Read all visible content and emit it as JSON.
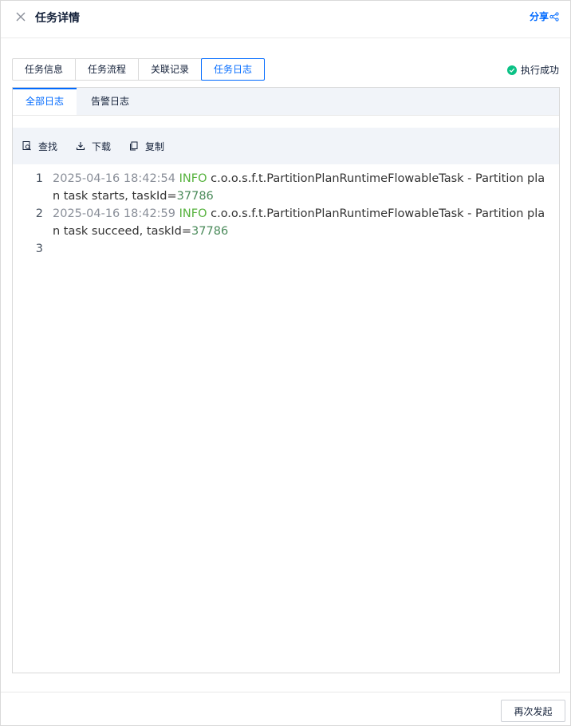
{
  "header": {
    "title": "任务详情",
    "share_label": "分享"
  },
  "tabs": [
    {
      "label": "任务信息",
      "active": false
    },
    {
      "label": "任务流程",
      "active": false
    },
    {
      "label": "关联记录",
      "active": false
    },
    {
      "label": "任务日志",
      "active": true
    }
  ],
  "status": {
    "label": "执行成功",
    "color": "#0ac185"
  },
  "subtabs": [
    {
      "label": "全部日志",
      "active": true
    },
    {
      "label": "告警日志",
      "active": false
    }
  ],
  "toolbar": {
    "search_label": "查找",
    "download_label": "下载",
    "copy_label": "复制"
  },
  "log_lines": [
    {
      "number": "1",
      "timestamp": "2025-04-16 18:42:54",
      "level": "INFO",
      "message": "c.o.o.s.f.t.PartitionPlanRuntimeFlowableTask - Partition plan task starts, taskId=",
      "task_id": "37786"
    },
    {
      "number": "2",
      "timestamp": "2025-04-16 18:42:59",
      "level": "INFO",
      "message": "c.o.o.s.f.t.PartitionPlanRuntimeFlowableTask - Partition plan task succeed, taskId=",
      "task_id": "37786"
    },
    {
      "number": "3",
      "timestamp": "",
      "level": "",
      "message": "",
      "task_id": ""
    }
  ],
  "footer": {
    "resubmit_label": "再次发起"
  },
  "colors": {
    "accent": "#006aff",
    "success": "#0ac185",
    "info": "#55b23c"
  }
}
